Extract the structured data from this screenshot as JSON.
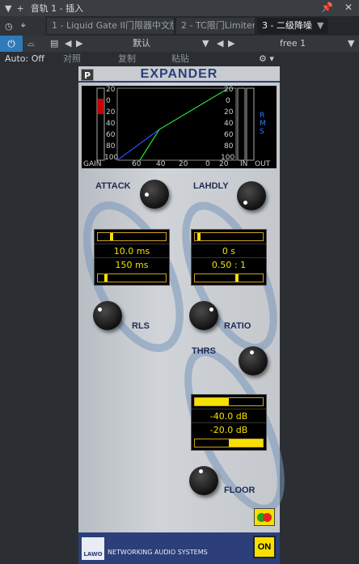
{
  "window": {
    "title": "音轨 1 - 插入"
  },
  "tabs": [
    {
      "label": "1 - Liquid Gate II门限器中文版",
      "active": false
    },
    {
      "label": "2 - TC限门Limiter",
      "active": false
    },
    {
      "label": "3 - 二级降噪",
      "active": true
    }
  ],
  "controls": {
    "preset": "默认",
    "preset2": "free 1",
    "auto": "Auto: Off",
    "compare": "对照",
    "copy": "复制",
    "paste": "粘贴"
  },
  "plugin": {
    "p_label": "P",
    "title": "EXPANDER",
    "scope": {
      "left_scale": [
        "20",
        "0",
        "20",
        "40",
        "60",
        "80",
        "100"
      ],
      "right_scale": [
        "20",
        "0",
        "20",
        "40",
        "60",
        "80",
        "100"
      ],
      "x_scale": [
        "60",
        "40",
        "20",
        "0",
        "20"
      ],
      "gain": "GAIN",
      "in": "IN",
      "out": "OUT",
      "rms": "RMS"
    },
    "attack": {
      "label": "ATTACK",
      "value": "10.0 ms",
      "bar_level": 0.18
    },
    "release": {
      "label": "RLS",
      "value": "150 ms",
      "bar_level": 0.1
    },
    "lahdly": {
      "label": "LAHDLY",
      "value": "0 s",
      "bar_level": 0.03
    },
    "ratio": {
      "label": "RATIO",
      "value": "0.50 : 1",
      "bar_level": 0.6
    },
    "thrs": {
      "label": "THRS",
      "value": "-40.0 dB",
      "bar_level": 0.5
    },
    "floor": {
      "label": "FLOOR",
      "value": "-20.0 dB",
      "bar_level": 0.5
    },
    "footer": {
      "logo": "LAWO",
      "text": "NETWORKING AUDIO SYSTEMS",
      "on": "ON"
    }
  }
}
